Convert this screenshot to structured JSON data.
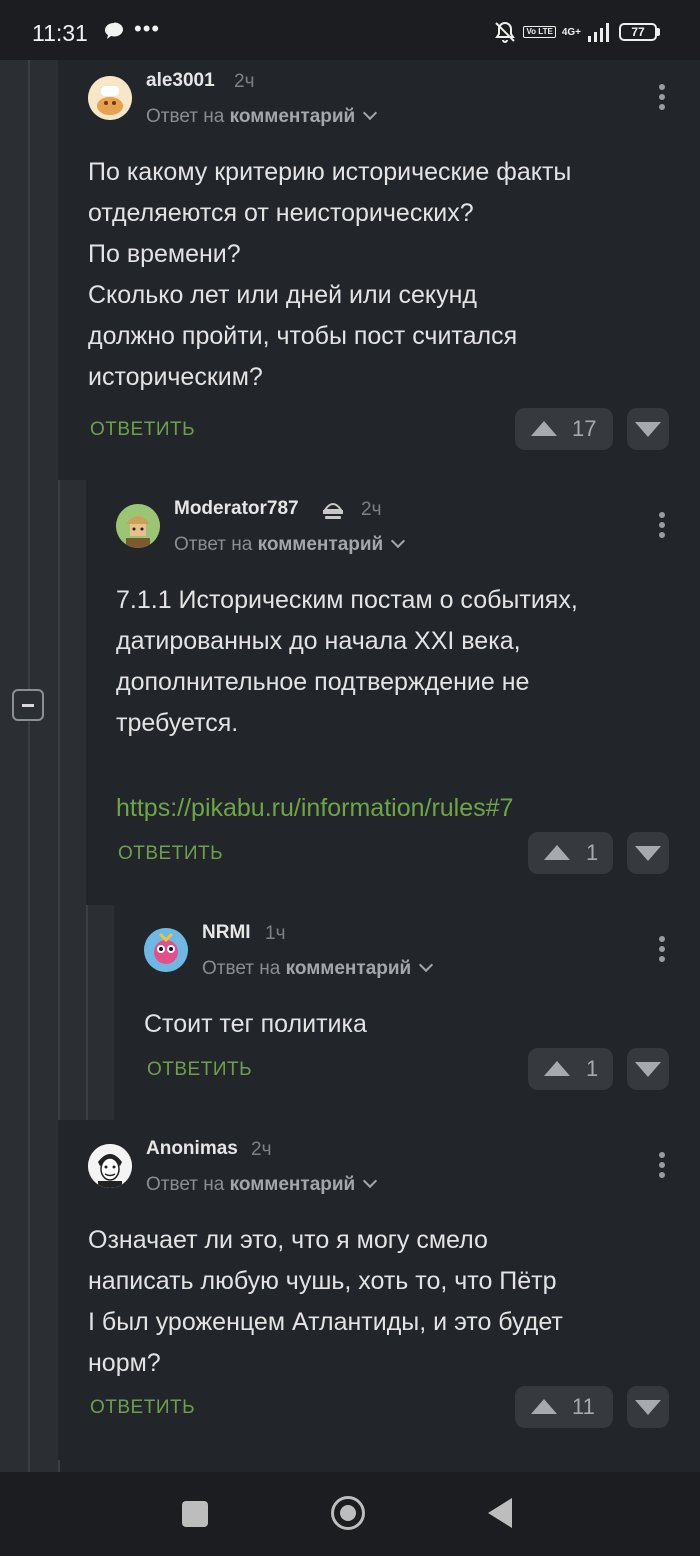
{
  "status_bar": {
    "time": "11:31",
    "network": "4G+",
    "volte": "Vo LTE",
    "battery": "77"
  },
  "comments": [
    {
      "user": "ale3001",
      "time": "2ч",
      "reply_prefix": "Ответ на",
      "reply_target": "комментарий",
      "lines": [
        "По какому критерию исторические факты",
        "отделяеются от неисторических?",
        "По времени?",
        "Сколько лет или дней или секунд",
        "должно пройти, чтобы пост считался",
        "историческим?"
      ],
      "reply_label": "ОТВЕТИТЬ",
      "votes": "17"
    },
    {
      "user": "Moderator787",
      "time": "2ч",
      "reply_prefix": "Ответ на",
      "reply_target": "комментарий",
      "lines": [
        "7.1.1 Историческим постам о событиях,",
        "датированных до начала XXI века,",
        "дополнительное подтверждение не",
        "требуется."
      ],
      "link": "https://pikabu.ru/information/rules#7",
      "reply_label": "ОТВЕТИТЬ",
      "votes": "1"
    },
    {
      "user": "NRMI",
      "time": "1ч",
      "reply_prefix": "Ответ на",
      "reply_target": "комментарий",
      "lines": [
        "Стоит тег политика"
      ],
      "reply_label": "ОТВЕТИТЬ",
      "votes": "1"
    },
    {
      "user": "Anonimas",
      "time": "2ч",
      "reply_prefix": "Ответ на",
      "reply_target": "комментарий",
      "lines": [
        "Означает ли это, что я могу смело",
        "написать любую чушь, хоть то, что Пётр",
        "I был уроженцем Атлантиды, и это будет",
        "норм?"
      ],
      "reply_label": "ОТВЕТИТЬ",
      "votes": "11"
    }
  ],
  "colors": {
    "background": "#22262a",
    "reply_green": "#6f9e4c",
    "link_green": "#6ea545"
  }
}
